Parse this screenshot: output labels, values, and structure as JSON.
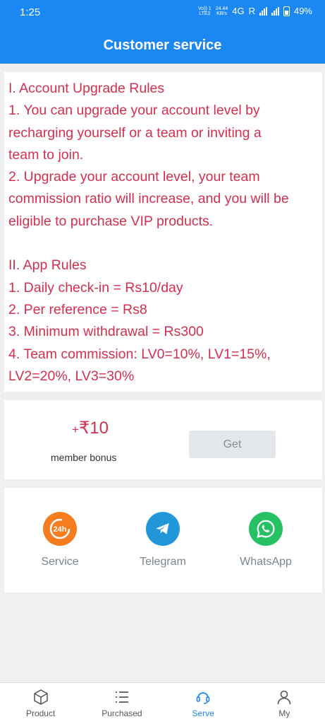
{
  "status": {
    "time": "1:25",
    "volte_top": "Vo)) 1",
    "volte_bottom": "LTE2",
    "speed_top": "24.44",
    "speed_bottom": "KB/s",
    "network": "4G",
    "roaming": "R",
    "battery": "49%"
  },
  "header": {
    "title": "Customer service"
  },
  "rules": {
    "lines": [
      "I. Account Upgrade Rules",
      "1. You can upgrade your account level by",
      "recharging yourself or a team or inviting a",
      "team to join.",
      "2. Upgrade your account level, your team",
      "commission ratio will increase, and you will be",
      "eligible to purchase VIP products.",
      "",
      "II. App Rules",
      "1. Daily check-in = Rs10/day",
      "2. Per reference = Rs8",
      "3. Minimum withdrawal = Rs300",
      "4. Team commission: LV0=10%, LV1=15%,",
      "LV2=20%, LV3=30%"
    ]
  },
  "bonus": {
    "plus": "+",
    "currency": "₹",
    "amount": "10",
    "label": "member bonus",
    "button": "Get"
  },
  "contacts": [
    {
      "name": "Service",
      "icon": "24h-service-icon",
      "color": "#f57c1f"
    },
    {
      "name": "Telegram",
      "icon": "telegram-icon",
      "color": "#2196d8"
    },
    {
      "name": "WhatsApp",
      "icon": "whatsapp-icon",
      "color": "#25c162"
    }
  ],
  "tabs": [
    {
      "label": "Product",
      "icon": "box-icon"
    },
    {
      "label": "Purchased",
      "icon": "list-icon"
    },
    {
      "label": "Serve",
      "icon": "headset-icon",
      "active": true
    },
    {
      "label": "My",
      "icon": "user-icon"
    }
  ],
  "colors": {
    "primary": "#1a87f2",
    "rules_text": "#d32f4f",
    "background": "#f0f0f0"
  }
}
